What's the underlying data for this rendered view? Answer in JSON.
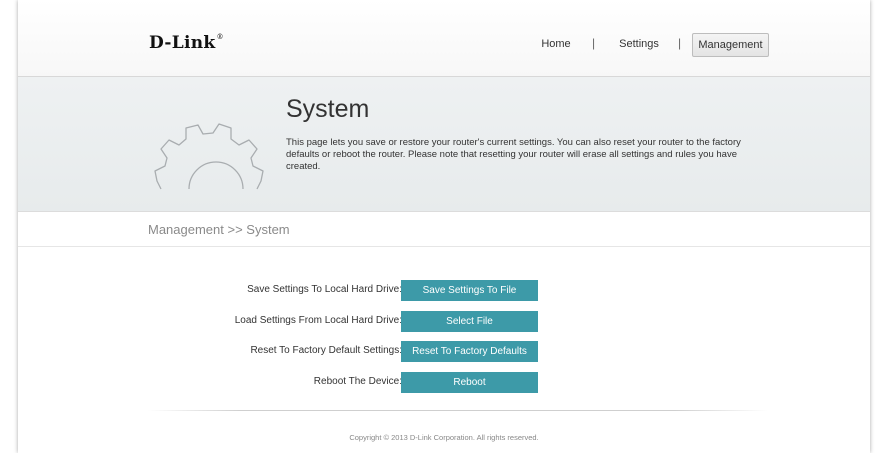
{
  "header": {
    "logo_text": "D-Link",
    "logo_tm": "®",
    "nav": {
      "home": "Home",
      "settings": "Settings",
      "management": "Management",
      "separator": "|"
    }
  },
  "banner": {
    "icon": "gear-icon",
    "title": "System",
    "description": "This page lets you save or restore your router's current settings. You can also reset your router to the factory defaults or reboot the router. Please note that resetting your router will erase all settings and rules you have created."
  },
  "breadcrumb": "Management >> System",
  "settings": {
    "save": {
      "label": "Save Settings To Local Hard Drive:",
      "button": "Save Settings To File"
    },
    "load": {
      "label": "Load Settings From Local Hard Drive:",
      "button": "Select File"
    },
    "reset": {
      "label": "Reset To Factory Default Settings:",
      "button": "Reset To Factory Defaults"
    },
    "reboot": {
      "label": "Reboot The Device:",
      "button": "Reboot"
    }
  },
  "footer": {
    "copyright": "Copyright © 2013 D-Link Corporation. All rights reserved."
  },
  "colors": {
    "button_bg": "#3d9aa8",
    "banner_bg": "#eef1f2"
  }
}
